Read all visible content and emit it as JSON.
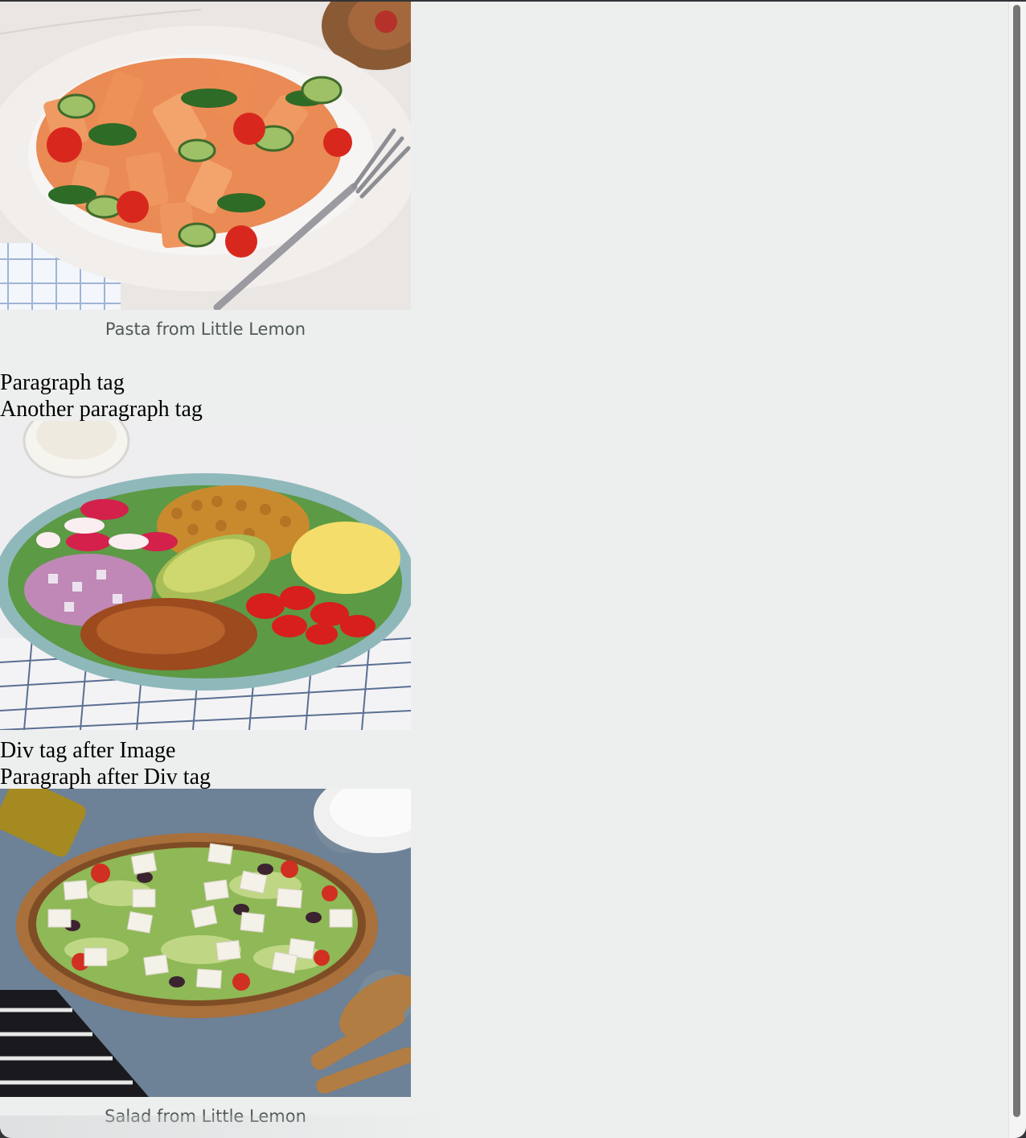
{
  "page": {
    "background": "#edeeee",
    "caption_color": "#4f5a57"
  },
  "figure_pasta": {
    "image_icon": "pasta-photo",
    "caption": "Pasta from Little Lemon"
  },
  "paragraph_1": "Paragraph tag",
  "paragraph_2": "Another paragraph tag",
  "figure_salad_bowl": {
    "image_icon": "cobb-salad-photo"
  },
  "div_after_image": "Div tag after Image",
  "paragraph_after_div": "Paragraph after Div tag",
  "figure_salad": {
    "image_icon": "greek-salad-photo",
    "caption": "Salad from Little Lemon"
  }
}
